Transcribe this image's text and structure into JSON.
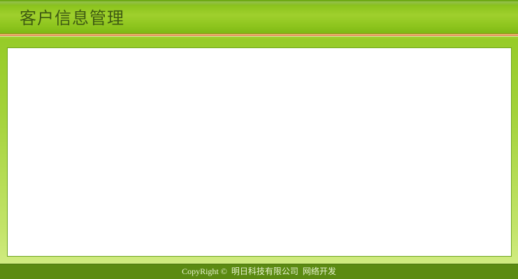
{
  "header": {
    "title": "客户信息管理"
  },
  "footer": {
    "copyright": "CopyRight ©  明日科技有限公司  网络开发"
  },
  "colors": {
    "header_green": "#8cc41d",
    "title_text": "#3e5a12",
    "footer_bg": "#5b8a12",
    "footer_text": "#e8f4cf",
    "panel_bg": "#ffffff"
  }
}
